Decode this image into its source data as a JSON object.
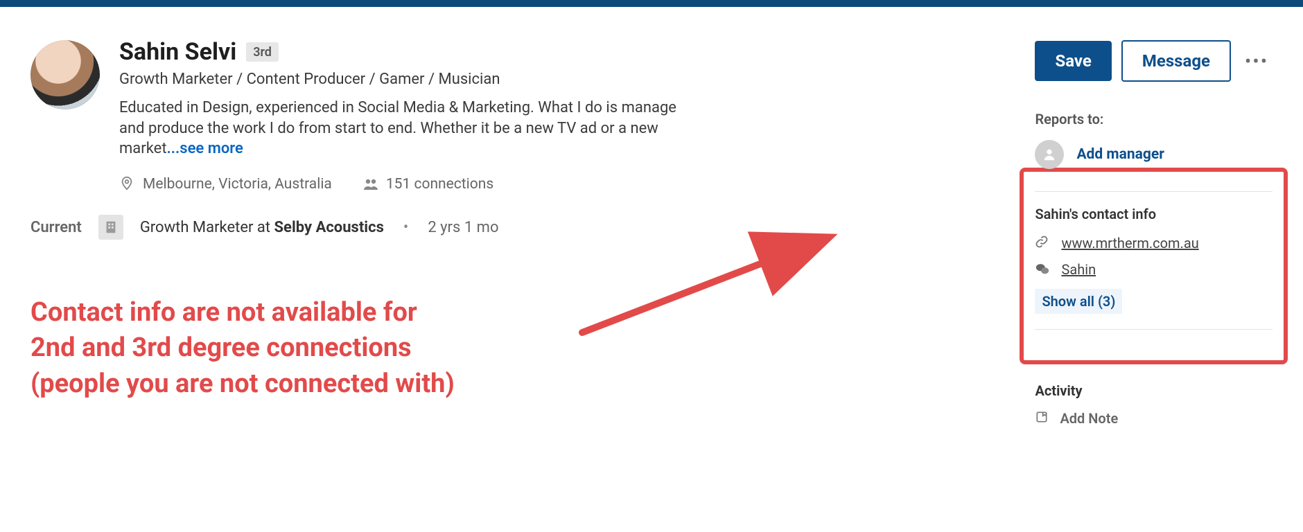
{
  "profile": {
    "name": "Sahin Selvi",
    "degree": "3rd",
    "headline": "Growth Marketer / Content Producer / Gamer / Musician",
    "bio_visible": "Educated in Design, experienced in Social Media & Marketing. What I do is manage and produce the work I do from start to end. Whether it be a new TV ad or a new market",
    "see_more": "...see more",
    "location": "Melbourne, Victoria, Australia",
    "connections": "151 connections"
  },
  "current": {
    "label": "Current",
    "role_prefix": "Growth Marketer at ",
    "company": "Selby Acoustics",
    "tenure": "2 yrs 1 mo"
  },
  "actions": {
    "save": "Save",
    "message": "Message"
  },
  "sidebar": {
    "reports_to": "Reports to:",
    "add_manager": "Add manager",
    "contact_title": "Sahin's contact info",
    "contact": {
      "website": "www.mrtherm.com.au",
      "wechat": "Sahin",
      "show_all": "Show all (3)"
    },
    "activity": "Activity",
    "add_note": "Add Note"
  },
  "annotation": {
    "line1": "Contact info are not available for",
    "line2": "2nd and 3rd degree connections",
    "line3": "(people you are not connected with)"
  }
}
